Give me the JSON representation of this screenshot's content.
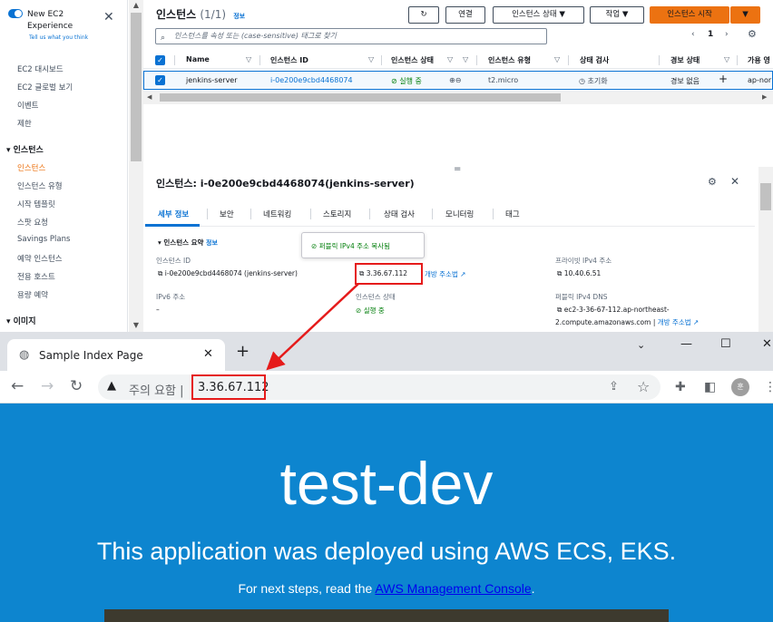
{
  "sidebar": {
    "experience_title": "New EC2 Experience",
    "experience_link": "Tell us what you think",
    "items_top": [
      "EC2 대시보드",
      "EC2 글로벌 보기",
      "이벤트",
      "제한"
    ],
    "section_instances": "인스턴스",
    "instances_items": [
      "인스턴스",
      "인스턴스 유형",
      "시작 템플릿",
      "스팟 요청",
      "Savings Plans",
      "예약 인스턴스",
      "전용 호스트",
      "용량 예약"
    ],
    "section_images": "이미지"
  },
  "instances": {
    "title": "인스턴스",
    "count": "(1/1)",
    "info": "정보",
    "refresh_icon": "refresh-icon",
    "connect": "연결",
    "state_menu": "인스턴스 상태",
    "actions_menu": "작업",
    "launch": "인스턴스 시작",
    "search_placeholder": "인스턴스를 속성 또는 (case-sensitive) 태그로 찾기",
    "page": "1",
    "columns": [
      "Name",
      "인스턴스 ID",
      "인스턴스 상태",
      "인스턴스 유형",
      "상태 검사",
      "경보 상태",
      "가용 영"
    ],
    "row": {
      "name": "jenkins-server",
      "id": "i-0e200e9cbd4468074",
      "state": "실행 중",
      "type": "t2.micro",
      "check": "초기화",
      "alarm": "경보 없음",
      "az": "ap-nor"
    }
  },
  "detail": {
    "title": "인스턴스: i-0e200e9cbd4468074(jenkins-server)",
    "tabs": [
      "세부 정보",
      "보안",
      "네트워킹",
      "스토리지",
      "상태 검사",
      "모니터링",
      "태그"
    ],
    "summary_title": "인스턴스 요약",
    "summary_info": "정보",
    "tooltip": "퍼블릭 IPv4 주소 복사됨",
    "instance_id_label": "인스턴스 ID",
    "instance_id_value": "i-0e200e9cbd4468074 (jenkins-server)",
    "public_ip_value": "3.36.67.112",
    "open_address": "개방 주소법",
    "private_ip_label": "프라이빗 IPv4 주소",
    "private_ip_value": "10.40.6.51",
    "ipv6_label": "IPv6 주소",
    "ipv6_value": "–",
    "state_label": "인스턴스 상태",
    "state_value": "실행 중",
    "public_dns_label": "퍼블릭 IPv4 DNS",
    "public_dns_value_1": "ec2-3-36-67-112.ap-northeast-",
    "public_dns_value_2": "2.compute.amazonaws.com",
    "public_dns_link": "개방 주소법"
  },
  "browser": {
    "tab_title": "Sample Index Page",
    "warning": "주의 요함",
    "url": "3.36.67.112",
    "avatar_text": "훈"
  },
  "page": {
    "heading": "test-dev",
    "subheading": "This application was deployed using AWS ECS, EKS.",
    "next_steps_prefix": "For next steps, read the ",
    "console_link": "AWS Management Console",
    "next_steps_suffix": "."
  },
  "colors": {
    "aws_orange": "#ec7211",
    "aws_blue": "#0972d3",
    "page_bg": "#0d85cf",
    "highlight": "#e51b1b"
  }
}
